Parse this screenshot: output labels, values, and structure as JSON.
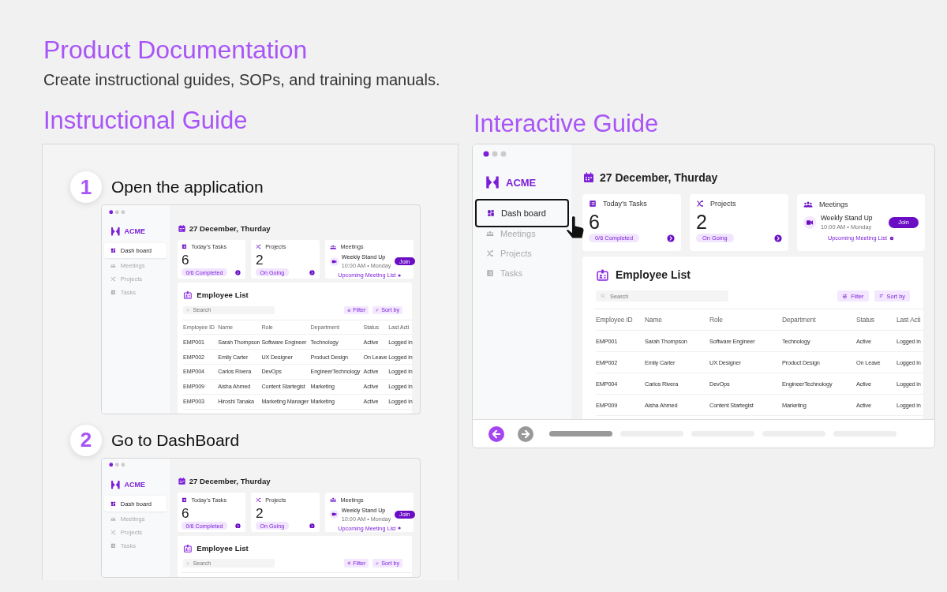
{
  "header": {
    "title": "Product Documentation",
    "subtitle": "Create instructional guides, SOPs, and training manuals."
  },
  "instructional_guide": {
    "title": "Instructional Guide",
    "steps": [
      {
        "number": "1",
        "title": "Open the application",
        "app": {
          "brand": "ACME",
          "nav": [
            {
              "label": "Dash board",
              "kind": "dashboard",
              "selected": true,
              "highlighted": false
            },
            {
              "label": "Meetings",
              "kind": "meetings",
              "selected": false,
              "highlighted": false
            },
            {
              "label": "Projects",
              "kind": "projects",
              "selected": false,
              "highlighted": false
            },
            {
              "label": "Tasks",
              "kind": "tasks",
              "selected": false,
              "highlighted": false
            }
          ],
          "date": "27 December, Thurday",
          "cards": [
            {
              "kind": "tasks",
              "title": "Today’s Tasks",
              "value": "6",
              "badge": "0/6 Completed"
            },
            {
              "kind": "projects",
              "title": "Projects",
              "value": "2",
              "badge": "On Going"
            },
            {
              "kind": "meetings",
              "title": "Meetings",
              "meeting": "Weekly Stand Up",
              "time": "10:00 AM • Monday",
              "join": "Join",
              "link": "Upcoming Meeting List"
            }
          ],
          "employee_list": {
            "title": "Employee List",
            "search_placeholder": "Search",
            "filter": "Filter",
            "sort": "Sort by",
            "columns": [
              "Employee ID",
              "Name",
              "Role",
              "Department",
              "Status",
              "Last Acti"
            ],
            "rows": [
              [
                "EMP001",
                "Sarah Thompson",
                "Software Engineer",
                "Technology",
                "Active",
                "Logged in"
              ],
              [
                "EMP002",
                "Emily Carter",
                "UX Designer",
                "Product Design",
                "On Leave",
                "Logged in"
              ],
              [
                "EMP004",
                "Carlos Rivera",
                "DevOps",
                "EngineerTechnology",
                "Active",
                "Logged in"
              ],
              [
                "EMP009",
                "Aisha Ahmed",
                "Content Startegist",
                "Marketing",
                "Active",
                "Logged in"
              ],
              [
                "EMP003",
                "Hiroshi Tanaka",
                "Marketing Manager",
                "Marketing",
                "Active",
                "Logged in"
              ]
            ]
          }
        }
      },
      {
        "number": "2",
        "title": "Go to DashBoard",
        "app": {
          "brand": "ACME",
          "nav": [
            {
              "label": "Dash board",
              "kind": "dashboard",
              "selected": true,
              "highlighted": false
            },
            {
              "label": "Meetings",
              "kind": "meetings",
              "selected": false,
              "highlighted": false
            },
            {
              "label": "Projects",
              "kind": "projects",
              "selected": false,
              "highlighted": false
            },
            {
              "label": "Tasks",
              "kind": "tasks",
              "selected": false,
              "highlighted": false
            }
          ],
          "date": "27 December, Thurday",
          "cards": [
            {
              "kind": "tasks",
              "title": "Today’s Tasks",
              "value": "6",
              "badge": "0/6 Completed"
            },
            {
              "kind": "projects",
              "title": "Projects",
              "value": "2",
              "badge": "On Going"
            },
            {
              "kind": "meetings",
              "title": "Meetings",
              "meeting": "Weekly Stand Up",
              "time": "10:00 AM • Monday",
              "join": "Join",
              "link": "Upcoming Meeting List"
            }
          ],
          "employee_list": {
            "title": "Employee List",
            "search_placeholder": "Search",
            "filter": "Filter",
            "sort": "Sort by"
          }
        }
      }
    ]
  },
  "interactive_guide": {
    "title": "Interactive Guide",
    "app": {
      "brand": "ACME",
      "nav": [
        {
          "label": "Dash board",
          "kind": "dashboard",
          "selected": true,
          "highlighted": true
        },
        {
          "label": "Meetings",
          "kind": "meetings",
          "selected": false,
          "highlighted": false
        },
        {
          "label": "Projects",
          "kind": "projects",
          "selected": false,
          "highlighted": false
        },
        {
          "label": "Tasks",
          "kind": "tasks",
          "selected": false,
          "highlighted": false
        }
      ],
      "date": "27 December, Thurday",
      "cards": [
        {
          "kind": "tasks",
          "title": "Today’s Tasks",
          "value": "6",
          "badge": "0/6 Completed"
        },
        {
          "kind": "projects",
          "title": "Projects",
          "value": "2",
          "badge": "On Going"
        },
        {
          "kind": "meetings",
          "title": "Meetings",
          "meeting": "Weekly Stand Up",
          "time": "10:00 AM • Monday",
          "join": "Join",
          "link": "Upcoming Meeting List"
        }
      ],
      "employee_list": {
        "title": "Employee List",
        "search_placeholder": "Search",
        "filter": "Filter",
        "sort": "Sort by",
        "columns": [
          "Employee ID",
          "Name",
          "Role",
          "Department",
          "Status",
          "Last Acti"
        ],
        "rows": [
          [
            "EMP001",
            "Sarah Thompson",
            "Software Engineer",
            "Technology",
            "Active",
            "Logged in"
          ],
          [
            "EMP002",
            "Emily Carter",
            "UX Designer",
            "Product Design",
            "On Leave",
            "Logged in"
          ],
          [
            "EMP004",
            "Carlos Rivera",
            "DevOps",
            "EngineerTechnology",
            "Active",
            "Logged in"
          ],
          [
            "EMP009",
            "Aisha Ahmed",
            "Content Startegist",
            "Marketing",
            "Active",
            "Logged in"
          ]
        ]
      }
    },
    "controls": {
      "back": {
        "disabled": false
      },
      "forward": {
        "disabled": true
      },
      "progress": [
        {
          "selected": true
        },
        {
          "selected": false
        },
        {
          "selected": false
        },
        {
          "selected": false
        },
        {
          "selected": false
        }
      ]
    }
  }
}
